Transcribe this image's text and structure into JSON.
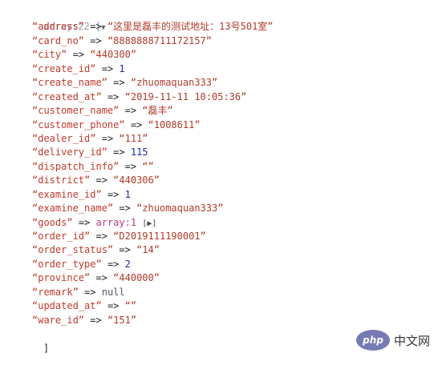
{
  "header": {
    "type_label": "array:22",
    "open_bracket": "[",
    "toggle_icon": "triangle-down-icon"
  },
  "entries": [
    {
      "key": "“address”",
      "arrow": "=>",
      "value": "“这里是磊丰的测试地址：13号501室”",
      "kind": "str"
    },
    {
      "key": "“card_no”",
      "arrow": "=>",
      "value": "“8888888711172157”",
      "kind": "str"
    },
    {
      "key": "“city”",
      "arrow": "=>",
      "value": "“440300”",
      "kind": "str"
    },
    {
      "key": "“create_id”",
      "arrow": "=>",
      "value": "1",
      "kind": "num"
    },
    {
      "key": "“create_name”",
      "arrow": "=>",
      "value": "“zhuomaquan333”",
      "kind": "str"
    },
    {
      "key": "“created_at”",
      "arrow": "=>",
      "value": "“2019-11-11 10:05:36”",
      "kind": "str"
    },
    {
      "key": "“customer_name”",
      "arrow": "=>",
      "value": "“磊丰”",
      "kind": "str"
    },
    {
      "key": "“customer_phone”",
      "arrow": "=>",
      "value": "“1008611”",
      "kind": "str"
    },
    {
      "key": "“dealer_id”",
      "arrow": "=>",
      "value": "“111”",
      "kind": "str"
    },
    {
      "key": "“delivery_id”",
      "arrow": "=>",
      "value": "115",
      "kind": "num"
    },
    {
      "key": "“dispatch_info”",
      "arrow": "=>",
      "value": "“”",
      "kind": "str"
    },
    {
      "key": "“district”",
      "arrow": "=>",
      "value": "“440306”",
      "kind": "str"
    },
    {
      "key": "“examine_id”",
      "arrow": "=>",
      "value": "1",
      "kind": "num"
    },
    {
      "key": "“examine_name”",
      "arrow": "=>",
      "value": "“zhuomaquan333”",
      "kind": "str"
    },
    {
      "key": "“goods”",
      "arrow": "=>",
      "value": "array:1",
      "kind": "arr",
      "suffix": "[▶]"
    },
    {
      "key": "“order_id”",
      "arrow": "=>",
      "value": "“D2019111190001”",
      "kind": "str"
    },
    {
      "key": "“order_status”",
      "arrow": "=>",
      "value": "“14”",
      "kind": "str"
    },
    {
      "key": "“order_type”",
      "arrow": "=>",
      "value": "2",
      "kind": "num"
    },
    {
      "key": "“province”",
      "arrow": "=>",
      "value": "“440000”",
      "kind": "str"
    },
    {
      "key": "“remark”",
      "arrow": "=>",
      "value": "null",
      "kind": "null"
    },
    {
      "key": "“updated_at”",
      "arrow": "=>",
      "value": "“”",
      "kind": "str"
    },
    {
      "key": "“ware_id”",
      "arrow": "=>",
      "value": "“151”",
      "kind": "str"
    }
  ],
  "footer": {
    "close_bracket": "]"
  },
  "watermark": {
    "logo_text": "php",
    "site_text": "中文网"
  }
}
